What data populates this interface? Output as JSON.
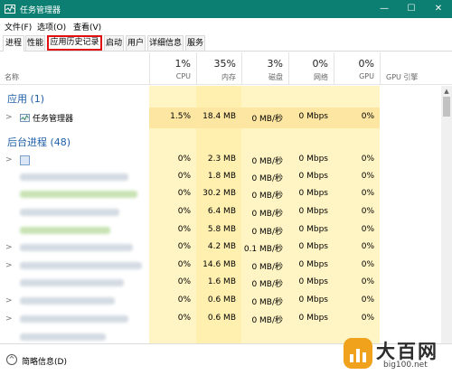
{
  "window": {
    "title": "任务管理器",
    "minimize": "—",
    "maximize": "☐",
    "close": "✕"
  },
  "menu": [
    "文件(F)",
    "选项(O)",
    "查看(V)"
  ],
  "tabs": [
    "进程",
    "性能",
    "应用历史记录",
    "启动",
    "用户",
    "详细信息",
    "服务"
  ],
  "columns": {
    "name_label": "名称",
    "cpu": {
      "pct": "1%",
      "label": "CPU"
    },
    "mem": {
      "pct": "35%",
      "label": "内存"
    },
    "disk": {
      "pct": "3%",
      "label": "磁盘"
    },
    "net": {
      "pct": "0%",
      "label": "网络"
    },
    "gpu": {
      "pct": "0%",
      "label": "GPU"
    },
    "gpuengine": {
      "label": "GPU 引擎"
    }
  },
  "groups": {
    "apps": "应用 (1)",
    "background": "后台进程 (48)"
  },
  "app_row": {
    "name": "任务管理器",
    "cpu": "1.5%",
    "mem": "18.4 MB",
    "disk": "0 MB/秒",
    "net": "0 Mbps",
    "gpu": "0%"
  },
  "bg_rows": [
    {
      "cpu": "0%",
      "mem": "2.3 MB",
      "disk": "0 MB/秒",
      "net": "0 Mbps",
      "gpu": "0%"
    },
    {
      "cpu": "0%",
      "mem": "1.8 MB",
      "disk": "0 MB/秒",
      "net": "0 Mbps",
      "gpu": "0%"
    },
    {
      "cpu": "0%",
      "mem": "30.2 MB",
      "disk": "0 MB/秒",
      "net": "0 Mbps",
      "gpu": "0%"
    },
    {
      "cpu": "0%",
      "mem": "6.4 MB",
      "disk": "0 MB/秒",
      "net": "0 Mbps",
      "gpu": "0%"
    },
    {
      "cpu": "0%",
      "mem": "5.8 MB",
      "disk": "0 MB/秒",
      "net": "0 Mbps",
      "gpu": "0%"
    },
    {
      "cpu": "0%",
      "mem": "4.2 MB",
      "disk": "0.1 MB/秒",
      "net": "0 Mbps",
      "gpu": "0%"
    },
    {
      "cpu": "0%",
      "mem": "14.6 MB",
      "disk": "0 MB/秒",
      "net": "0 Mbps",
      "gpu": "0%"
    },
    {
      "cpu": "0%",
      "mem": "1.6 MB",
      "disk": "0 MB/秒",
      "net": "0 Mbps",
      "gpu": "0%"
    },
    {
      "cpu": "0%",
      "mem": "0.6 MB",
      "disk": "0 MB/秒",
      "net": "0 Mbps",
      "gpu": "0%"
    },
    {
      "cpu": "0%",
      "mem": "0.6 MB",
      "disk": "0 MB/秒",
      "net": "0 Mbps",
      "gpu": "0%"
    }
  ],
  "footer": {
    "icon": "chevron-up-icon",
    "label": "简略信息(D)"
  },
  "watermark": {
    "title": "大百网",
    "url": "big100.net"
  },
  "colors": {
    "titlebar": "#0c7e72",
    "heat": "#fff4c4",
    "selected_heat": "#fde6a2",
    "highlight_border": "#e10f0f",
    "group_title": "#1e5fa8",
    "watermark_badge": "#f0a21d"
  }
}
